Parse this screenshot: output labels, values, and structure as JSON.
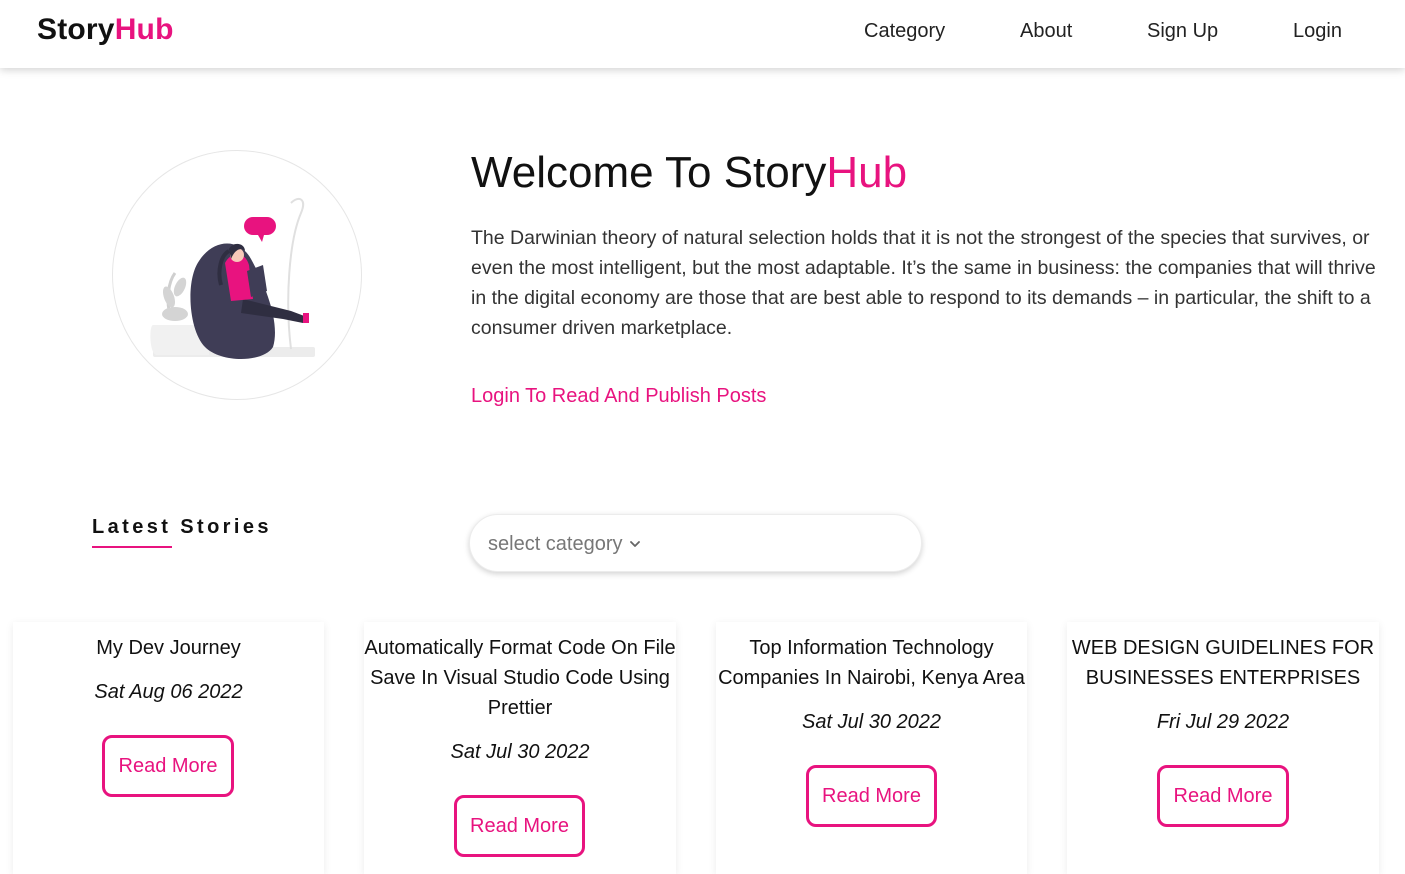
{
  "navbar": {
    "brand_part1": "Story",
    "brand_part2": "Hub",
    "links": [
      "Category",
      "About",
      "Sign Up",
      "Login"
    ]
  },
  "hero": {
    "title_part1": "Welcome To Story",
    "title_part2": "Hub",
    "text": "The Darwinian theory of natural selection holds that it is not the strongest of the species that survives, or even the most intelligent, but the most adaptable. It’s the same in business: the companies that will thrive in the digital economy are those that are best able to respond to its demands – in particular, the shift to a consumer driven marketplace.",
    "cta": "Login To Read And Publish Posts"
  },
  "latest": {
    "title": "Latest Stories",
    "select_placeholder": "select category"
  },
  "cards": [
    {
      "title": "My Dev Journey",
      "date": "Sat Aug 06 2022",
      "button": "Read More"
    },
    {
      "title": "Automatically Format Code On File Save In Visual Studio Code Using Prettier",
      "date": "Sat Jul 30 2022",
      "button": "Read More"
    },
    {
      "title": "Top Information Technology Companies In Nairobi, Kenya Area",
      "date": "Sat Jul 30 2022",
      "button": "Read More"
    },
    {
      "title": "WEB DESIGN GUIDELINES FOR BUSINESSES ENTERPRISES",
      "date": "Fri Jul 29 2022",
      "button": "Read More"
    }
  ],
  "colors": {
    "accent": "#e8137f",
    "text": "#111111",
    "muted": "#333333"
  },
  "icons": {
    "hero_illustration": "reading-person-illustration",
    "select_chevron": "chevron-down-icon"
  }
}
